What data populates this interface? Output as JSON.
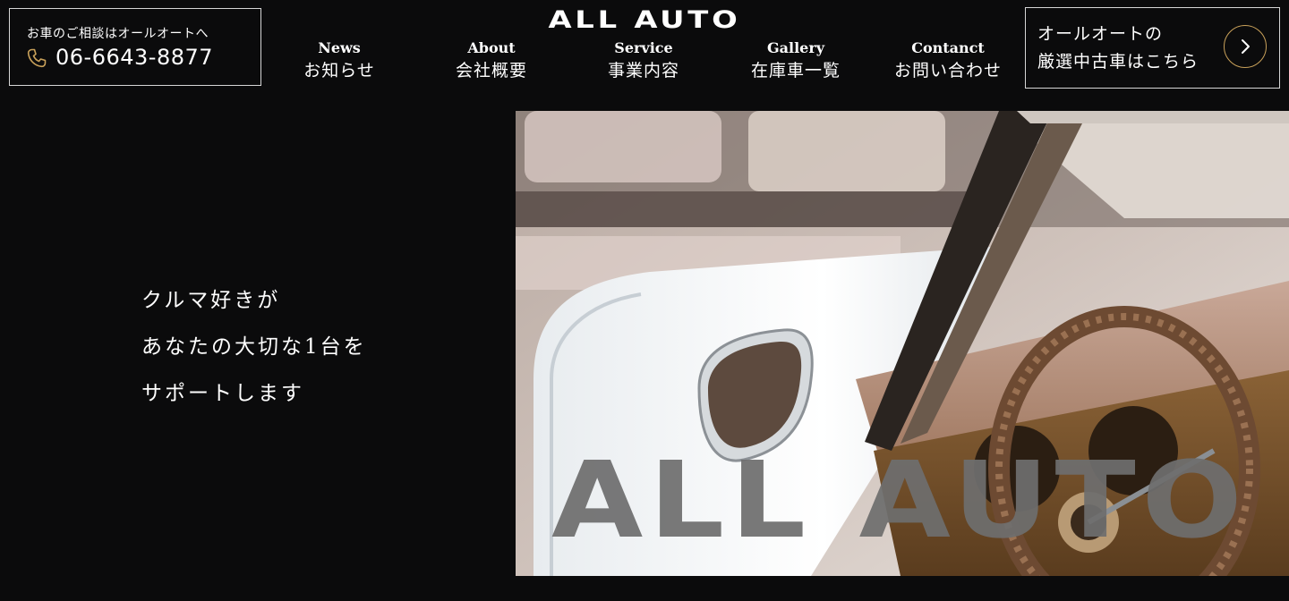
{
  "header": {
    "contact": {
      "caption": "お車のご相談はオールオートへ",
      "phone": "06-6643-8877",
      "icon": "phone-icon"
    },
    "logo": "ALL AUTO",
    "nav": [
      {
        "en": "News",
        "ja": "お知らせ"
      },
      {
        "en": "About",
        "ja": "会社概要"
      },
      {
        "en": "Service",
        "ja": "事業内容"
      },
      {
        "en": "Gallery",
        "ja": "在庫車一覧"
      },
      {
        "en": "Contanct",
        "ja": "お問い合わせ"
      }
    ],
    "cta": {
      "line1": "オールオートの",
      "line2": "厳選中古車はこちら",
      "icon": "chevron-right-icon"
    }
  },
  "hero": {
    "lines": [
      "クルマ好きが",
      "あなたの大切な1台を",
      "サポートします"
    ],
    "watermark": "ALL AUTO"
  },
  "colors": {
    "background": "#0b0b0c",
    "accent": "#c9a15a",
    "border": "#d6d6d6"
  }
}
